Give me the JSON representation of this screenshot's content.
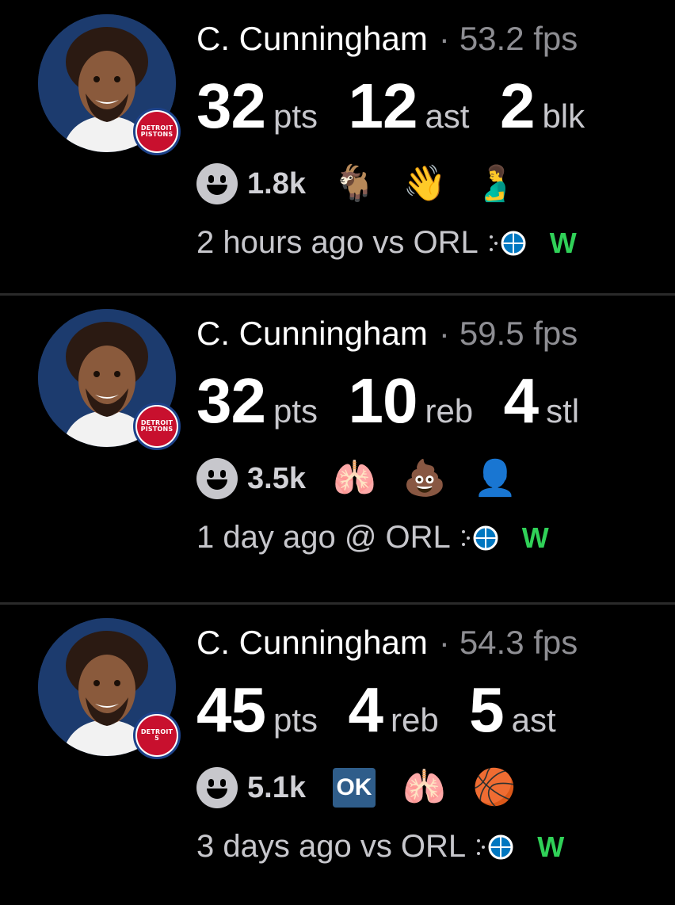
{
  "colors": {
    "background": "#000000",
    "muted": "#8e8e93",
    "win": "#30d158",
    "team_red": "#c8102e",
    "team_blue": "#1d428a"
  },
  "cards": [
    {
      "player": "C. Cunningham",
      "separator": "·",
      "fps": "53.2 fps",
      "team_badge_text": [
        "DETROIT",
        "PISTONS"
      ],
      "stats": [
        {
          "value": "32",
          "unit": "pts"
        },
        {
          "value": "12",
          "unit": "ast"
        },
        {
          "value": "2",
          "unit": "blk"
        }
      ],
      "reaction_count": "1.8k",
      "reactions": [
        {
          "icon": "goat-icon",
          "glyph": "🐐"
        },
        {
          "icon": "waving-hand-icon",
          "glyph": "👋"
        },
        {
          "icon": "pregnant-man-icon",
          "glyph": "🫃"
        }
      ],
      "time": "2 hours ago vs ORL",
      "result": "W"
    },
    {
      "player": "C. Cunningham",
      "separator": "·",
      "fps": "59.5 fps",
      "team_badge_text": [
        "DETROIT",
        "PISTONS"
      ],
      "stats": [
        {
          "value": "32",
          "unit": "pts"
        },
        {
          "value": "10",
          "unit": "reb"
        },
        {
          "value": "4",
          "unit": "stl"
        }
      ],
      "reaction_count": "3.5k",
      "reactions": [
        {
          "icon": "lungs-icon",
          "glyph": "🫁"
        },
        {
          "icon": "poop-icon",
          "glyph": "💩"
        },
        {
          "icon": "person-in-mask-icon",
          "glyph": "👤"
        }
      ],
      "time": "1 day ago @ ORL",
      "result": "W"
    },
    {
      "player": "C. Cunningham",
      "separator": "·",
      "fps": "54.3 fps",
      "team_badge_text": [
        "DETROIT",
        "5"
      ],
      "stats": [
        {
          "value": "45",
          "unit": "pts"
        },
        {
          "value": "4",
          "unit": "reb"
        },
        {
          "value": "5",
          "unit": "ast"
        }
      ],
      "reaction_count": "5.1k",
      "reactions": [
        {
          "icon": "ok-button-icon",
          "glyph": "OK"
        },
        {
          "icon": "lungs-icon",
          "glyph": "🫁"
        },
        {
          "icon": "player-facepalm-icon",
          "glyph": "🏀"
        }
      ],
      "time": "3 days ago vs ORL",
      "result": "W"
    }
  ]
}
